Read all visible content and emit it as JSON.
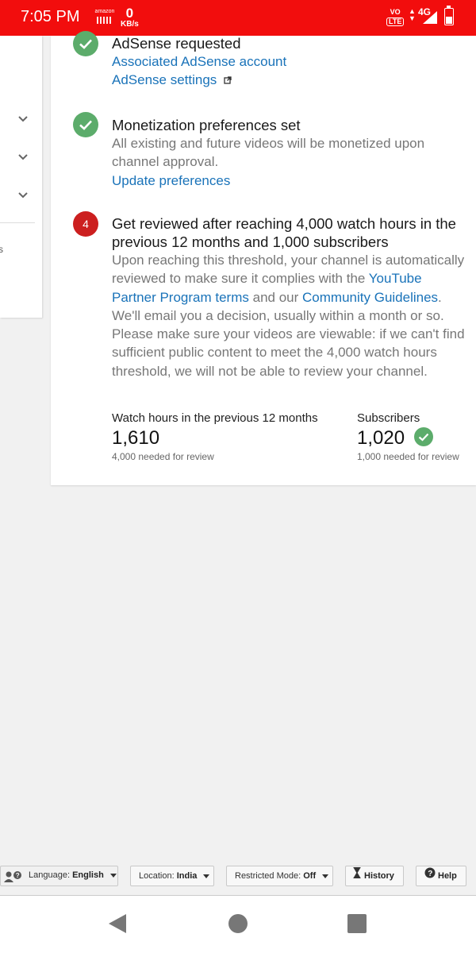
{
  "status_bar": {
    "time": "7:05 PM",
    "amazon_label": "amazon",
    "speed_value": "0",
    "speed_unit": "KB/s",
    "volte_top": "VO",
    "volte_bottom": "LTE",
    "network": "4G",
    "background_color": "#f20d0d"
  },
  "steps": [
    {
      "status": "complete",
      "title": "AdSense requested",
      "links": [
        "Associated AdSense account",
        "AdSense settings"
      ]
    },
    {
      "status": "complete",
      "title": "Monetization preferences set",
      "description": "All existing and future videos will be monetized upon channel approval.",
      "link": "Update preferences"
    },
    {
      "status": "pending",
      "number": "4",
      "title": "Get reviewed after reaching 4,000 watch hours in the previous 12 months and 1,000 subscribers",
      "desc_part1": "Upon reaching this threshold, your channel is automatically reviewed to make sure it complies with the",
      "link1": "YouTube Partner Program terms",
      "desc_part2": "and our",
      "link2": "Community Guidelines",
      "desc_part3": ". We'll email you a decision, usually within a month or so. Please make sure your videos are viewable: if we can't find sufficient public content to meet the 4,000 watch hours threshold, we will not be able to review your channel."
    }
  ],
  "stats": {
    "watch_hours": {
      "label": "Watch hours in the previous 12 months",
      "value": "1,610",
      "note": "4,000 needed for review"
    },
    "subscribers": {
      "label": "Subscribers",
      "value": "1,020",
      "note": "1,000 needed for review",
      "met": true
    }
  },
  "left_panel": {
    "partial_text": "s"
  },
  "footer": {
    "language_label": "Language:",
    "language_value": "English",
    "location_label": "Location:",
    "location_value": "India",
    "restricted_label": "Restricted Mode:",
    "restricted_value": "Off",
    "history_label": "History",
    "help_label": "Help"
  },
  "colors": {
    "link": "#1a73b9",
    "check_badge": "#5cac6b",
    "step_badge": "#cc1f1f"
  }
}
